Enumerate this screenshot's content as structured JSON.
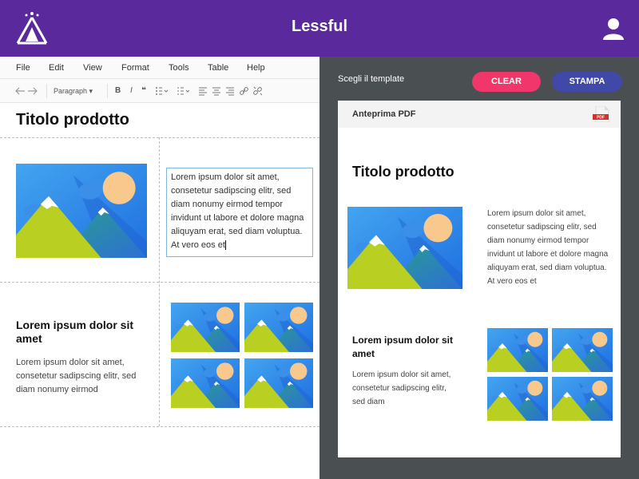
{
  "app": {
    "title": "Lessful",
    "logo_icon": "tent-logo-icon",
    "user_icon": "user-icon",
    "accent_color": "#5a2a9c"
  },
  "editor": {
    "menu": [
      "File",
      "Edit",
      "View",
      "Format",
      "Tools",
      "Table",
      "Help"
    ],
    "toolbar": {
      "block_format": "Paragraph",
      "buttons": [
        "undo-icon",
        "redo-icon",
        "bold-icon",
        "italic-icon",
        "quote-icon",
        "bullet-list-icon",
        "numbered-list-icon",
        "align-left-icon",
        "align-center-icon",
        "align-right-icon",
        "link-icon",
        "unlink-icon"
      ]
    },
    "document": {
      "title": "Titolo prodotto",
      "intro_text": "Lorem ipsum dolor sit amet, consetetur sadipscing elitr, sed diam nonumy eirmod tempor invidunt ut labore et dolore magna aliquyam erat, sed diam voluptua. At vero eos et",
      "section_heading": "Lorem ipsum dolor sit amet",
      "section_text": "Lorem ipsum dolor sit amet, consetetur sadipscing elitr, sed diam nonumy eirmod"
    }
  },
  "preview": {
    "choose_template": "Scegli il template",
    "clear_label": "CLEAR",
    "print_label": "STAMPA",
    "clear_color": "#f0366b",
    "print_color": "#4048a8",
    "card_header": "Anteprima PDF",
    "pdf_icon": "pdf-file-icon",
    "title": "Titolo prodotto",
    "intro_text": "Lorem ipsum dolor sit amet, consetetur sadipscing elitr, sed diam nonumy eirmod tempor invidunt ut labore et dolore magna aliquyam erat, sed diam voluptua. At vero eos et",
    "section_heading": "Lorem ipsum dolor sit amet",
    "section_text": "Lorem ipsum dolor sit amet, consetetur sadipscing elitr, sed diam"
  }
}
